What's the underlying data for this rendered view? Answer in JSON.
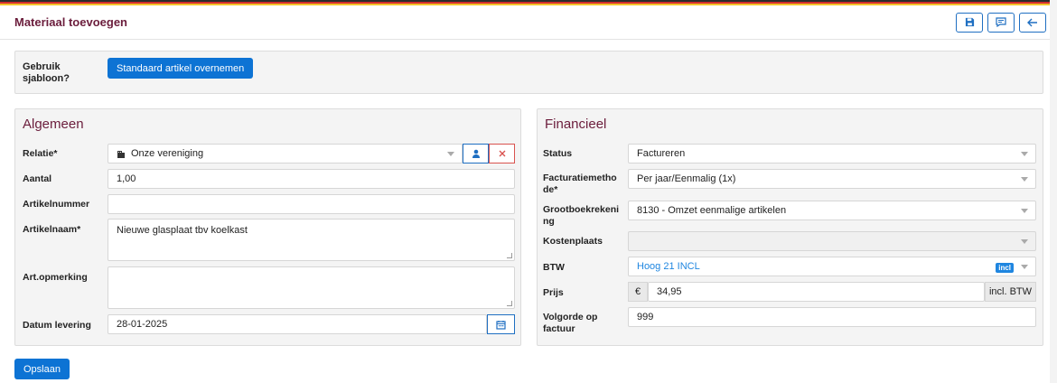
{
  "colors": {
    "accent": "#0d73d4",
    "title": "#6b1d3c",
    "flag": [
      "#2b2b2b",
      "#d32f2f",
      "#f3c42b"
    ]
  },
  "header": {
    "title": "Materiaal toevoegen",
    "icons": [
      "save-icon",
      "comment-icon",
      "arrow-left-icon"
    ]
  },
  "template": {
    "label": "Gebruik sjabloon?",
    "button": "Standaard artikel overnemen"
  },
  "algemeen": {
    "heading": "Algemeen",
    "relatie": {
      "label": "Relatie*",
      "value": "Onze vereniging"
    },
    "aantal": {
      "label": "Aantal",
      "value": "1,00"
    },
    "artikelnummer": {
      "label": "Artikelnummer",
      "value": ""
    },
    "artikelnaam": {
      "label": "Artikelnaam*",
      "value": "Nieuwe glasplaat tbv koelkast"
    },
    "opmerking": {
      "label": "Art.opmerking",
      "value": ""
    },
    "datum": {
      "label": "Datum levering",
      "value": "28-01-2025"
    }
  },
  "financieel": {
    "heading": "Financieel",
    "status": {
      "label": "Status",
      "value": "Factureren"
    },
    "methode": {
      "label": "Facturatiemethode*",
      "value": "Per jaar/Eenmalig (1x)"
    },
    "grootboek": {
      "label": "Grootboekrekening",
      "value": "8130 - Omzet eenmalige artikelen"
    },
    "kostenplaats": {
      "label": "Kostenplaats",
      "value": ""
    },
    "btw": {
      "label": "BTW",
      "value": "Hoog 21 INCL",
      "badge": "incl"
    },
    "prijs": {
      "label": "Prijs",
      "currency": "€",
      "value": "34,95",
      "suffix": "incl. BTW"
    },
    "volgorde": {
      "label": "Volgorde op factuur",
      "value": "999"
    }
  },
  "footer": {
    "save": "Opslaan"
  }
}
